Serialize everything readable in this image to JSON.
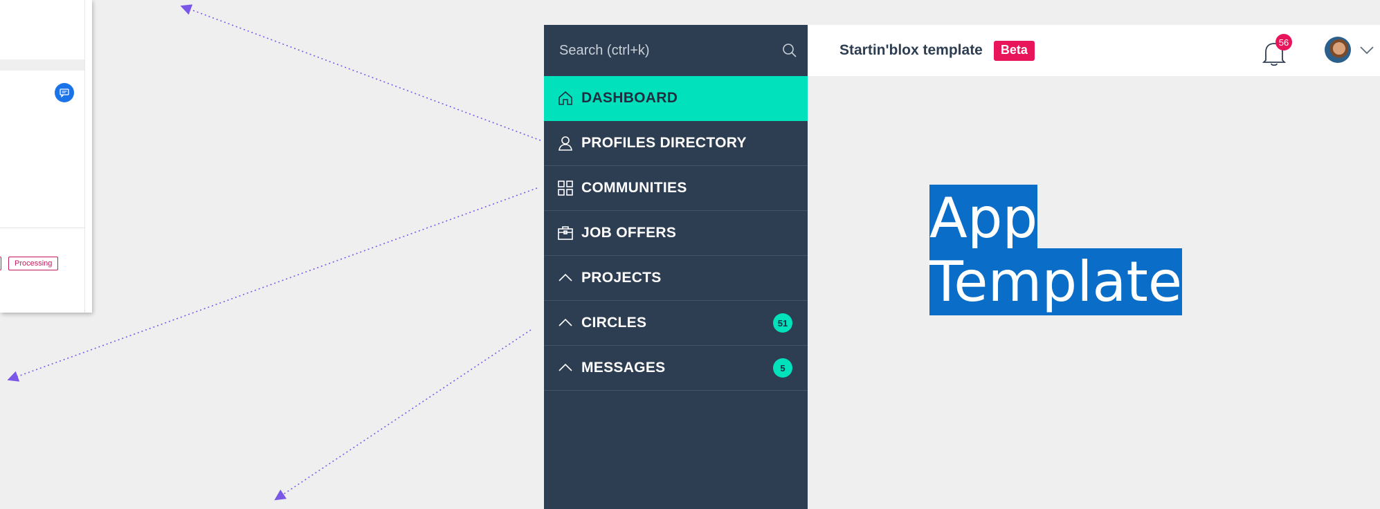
{
  "background_panel": {
    "tag_processing": "Processing"
  },
  "sidebar": {
    "search_placeholder": "Search (ctrl+k)",
    "items": [
      {
        "label": "DASHBOARD",
        "icon": "home-icon",
        "active": true
      },
      {
        "label": "PROFILES DIRECTORY",
        "icon": "user-icon",
        "active": false
      },
      {
        "label": "COMMUNITIES",
        "icon": "grid-icon",
        "active": false
      },
      {
        "label": "JOB OFFERS",
        "icon": "briefcase-icon",
        "active": false
      },
      {
        "label": "PROJECTS",
        "icon": "chevron-up-icon",
        "active": false
      },
      {
        "label": "CIRCLES",
        "icon": "chevron-up-icon",
        "active": false,
        "badge": "51"
      },
      {
        "label": "MESSAGES",
        "icon": "chevron-up-icon",
        "active": false,
        "badge": "5"
      }
    ]
  },
  "header": {
    "app_name": "Startin'blox template",
    "beta_label": "Beta",
    "notification_count": "56"
  },
  "main": {
    "hero_line1": "App",
    "hero_line2": "Template"
  },
  "colors": {
    "sidebar_bg": "#2e3e52",
    "accent": "#00e1bc",
    "beta_red": "#e8155b",
    "highlight_blue": "#0a6ec8"
  }
}
